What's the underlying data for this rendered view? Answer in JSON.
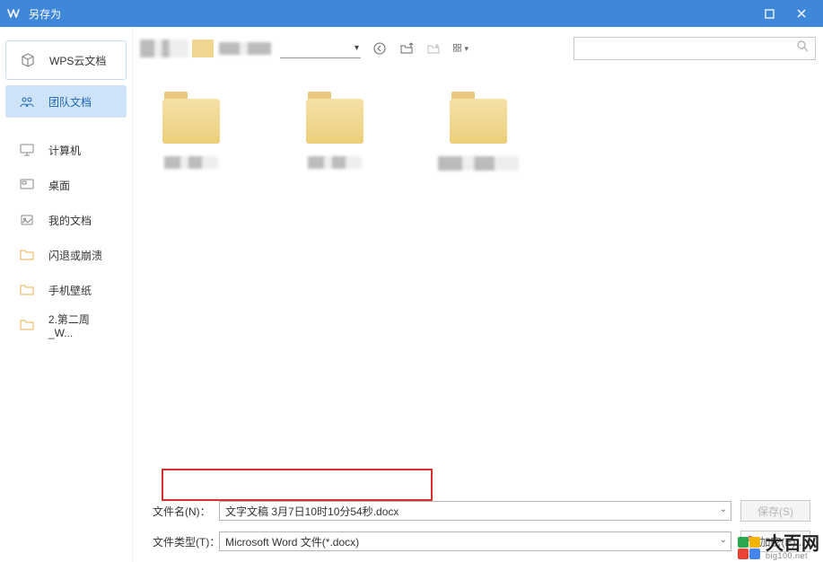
{
  "window": {
    "title": "另存为"
  },
  "sidebar": {
    "items": [
      {
        "label": "WPS云文档"
      },
      {
        "label": "团队文档"
      },
      {
        "label": "计算机"
      },
      {
        "label": "桌面"
      },
      {
        "label": "我的文档"
      },
      {
        "label": "闪退或崩溃"
      },
      {
        "label": "手机壁纸"
      },
      {
        "label": "2.第二周_W..."
      }
    ]
  },
  "form": {
    "filename_label": "文件名(N)：",
    "filename_value": "文字文稿 3月7日10时10分54秒.docx",
    "filetype_label": "文件类型(T)：",
    "filetype_value": "Microsoft Word 文件(*.docx)",
    "save_label": "保存(S)",
    "encrypt_label": "加密(E)..."
  },
  "watermark": {
    "brand": "大百网",
    "url": "big100.net"
  }
}
